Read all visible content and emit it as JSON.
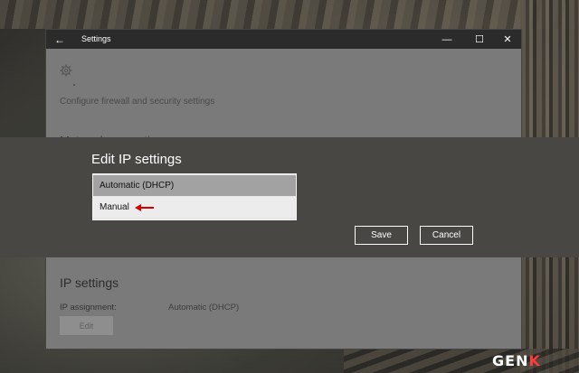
{
  "window": {
    "title": "Settings",
    "back_icon": "back-arrow-icon",
    "controls": {
      "minimize": "—",
      "maximize": "☐",
      "close": "✕"
    }
  },
  "page": {
    "firewall_link": "Configure firewall and security settings",
    "metered_heading": "Metered connection",
    "ip_section": {
      "heading": "IP settings",
      "assignment_label": "IP assignment:",
      "assignment_value": "Automatic (DHCP)",
      "edit_label": "Edit"
    }
  },
  "dialog": {
    "title": "Edit IP settings",
    "dropdown_options": [
      {
        "label": "Automatic (DHCP)"
      },
      {
        "label": "Manual"
      }
    ],
    "save_label": "Save",
    "cancel_label": "Cancel"
  },
  "watermark": {
    "text_main": "GEN",
    "text_accent": "K"
  },
  "colors": {
    "dialog_bg": "#484744",
    "titlebar_bg": "#2b2b2b",
    "annotation_arrow": "#d40000",
    "watermark_accent": "#ff3b3b"
  }
}
